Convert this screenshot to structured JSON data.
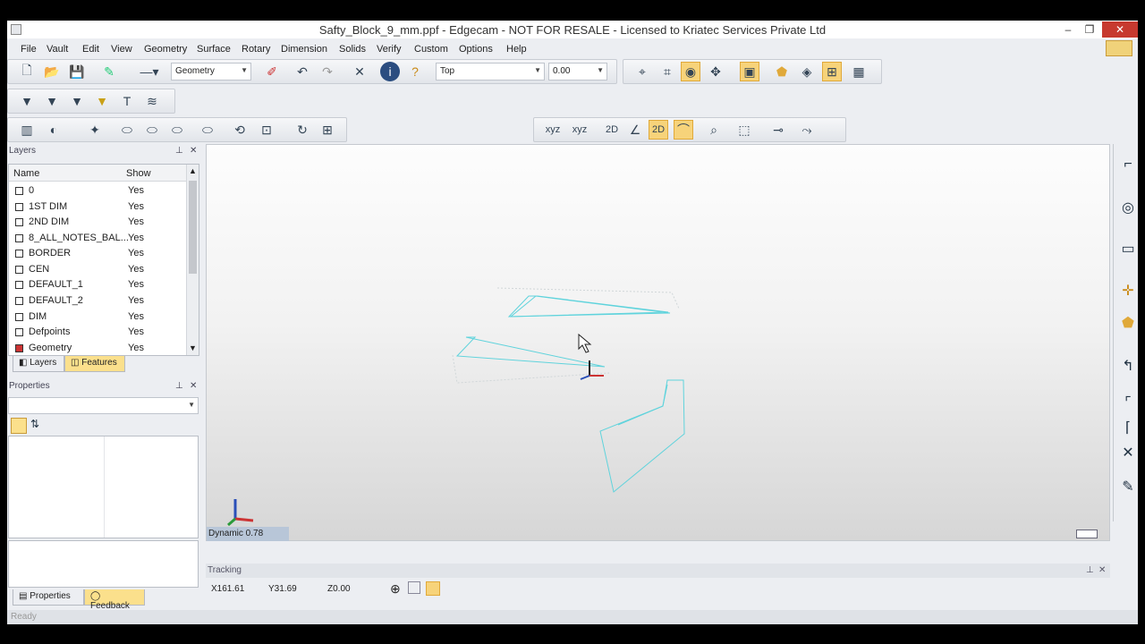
{
  "window": {
    "title": "Safty_Block_9_mm.ppf - Edgecam - NOT FOR RESALE - Licensed to Kriatec Services Private Ltd"
  },
  "menu": [
    "File",
    "Vault",
    "Edit",
    "View",
    "Geometry",
    "Surface",
    "Rotary",
    "Dimension",
    "Solids",
    "Verify",
    "Custom",
    "Options",
    "Help"
  ],
  "toolbar": {
    "layer_combo": "Geometry",
    "view_combo": "Top",
    "zlevel_combo": "0.00"
  },
  "toolbar2": {
    "xyz1": "xyz",
    "xyz2": "xyz",
    "twod1": "2D",
    "twod2": "2D"
  },
  "layers_panel": {
    "title": "Layers",
    "col_name": "Name",
    "col_show": "Show",
    "rows": [
      {
        "name": "0",
        "show": "Yes"
      },
      {
        "name": "1ST DIM",
        "show": "Yes"
      },
      {
        "name": "2ND DIM",
        "show": "Yes"
      },
      {
        "name": "8_ALL_NOTES_BAL...",
        "show": "Yes"
      },
      {
        "name": "BORDER",
        "show": "Yes"
      },
      {
        "name": "CEN",
        "show": "Yes"
      },
      {
        "name": "DEFAULT_1",
        "show": "Yes"
      },
      {
        "name": "DEFAULT_2",
        "show": "Yes"
      },
      {
        "name": "DIM",
        "show": "Yes"
      },
      {
        "name": "Defpoints",
        "show": "Yes"
      },
      {
        "name": "Geometry",
        "show": "Yes"
      }
    ],
    "tabs": [
      "Layers",
      "Features"
    ]
  },
  "properties_panel": {
    "title": "Properties",
    "tabs": [
      "Properties",
      "Feedback"
    ]
  },
  "viewport": {
    "dynamic_label": "Dynamic 0.78"
  },
  "tracking": {
    "title": "Tracking",
    "x": "X161.61",
    "y": "Y31.69",
    "z": "Z0.00"
  },
  "status": {
    "text": "Ready"
  },
  "colors": {
    "wire": "#5fd3dc",
    "highlight": "#f7d37a",
    "close_button": "#c7392f"
  }
}
